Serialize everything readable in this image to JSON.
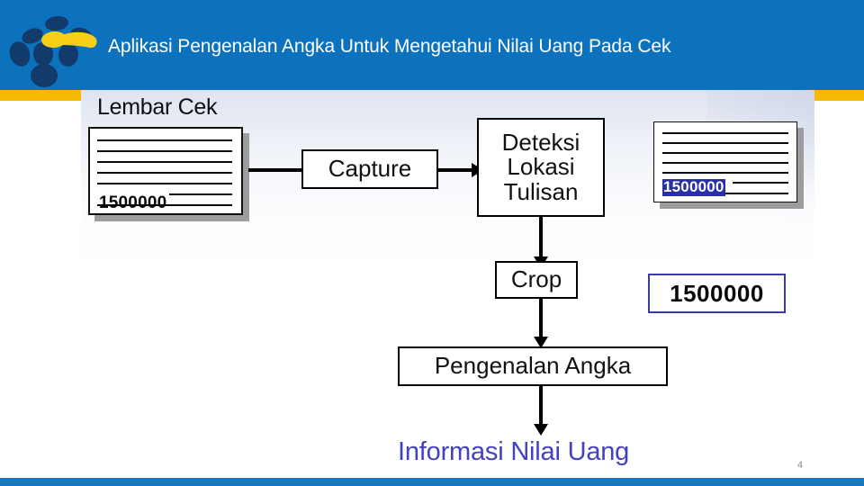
{
  "header": {
    "title": "Aplikasi Pengenalan Angka Untuk Mengetahui Nilai Uang Pada Cek",
    "bar_color": "#0c72bd",
    "accent_color": "#f5b906",
    "logo_name": "telkom-logo"
  },
  "diagram": {
    "caption_lembar_cek": "Lembar Cek",
    "cheque_amount": "1500000",
    "detected_amount": "1500000",
    "cropped_amount": "1500000",
    "nodes": [
      {
        "id": "capture",
        "label": "Capture"
      },
      {
        "id": "deteksi",
        "label": "Deteksi\nLokasi\nTulisan",
        "line1": "Deteksi",
        "line2": "Lokasi",
        "line3": "Tulisan"
      },
      {
        "id": "crop",
        "label": "Crop"
      },
      {
        "id": "pengenalan",
        "label": "Pengenalan Angka"
      }
    ],
    "final_output": "Informasi Nilai Uang",
    "final_output_color": "#4241c4",
    "highlight_color": "#2a2fa8",
    "result_border_color": "#3a3aa8"
  },
  "footer": {
    "page_number": "4",
    "bar_color": "#1679bd"
  }
}
